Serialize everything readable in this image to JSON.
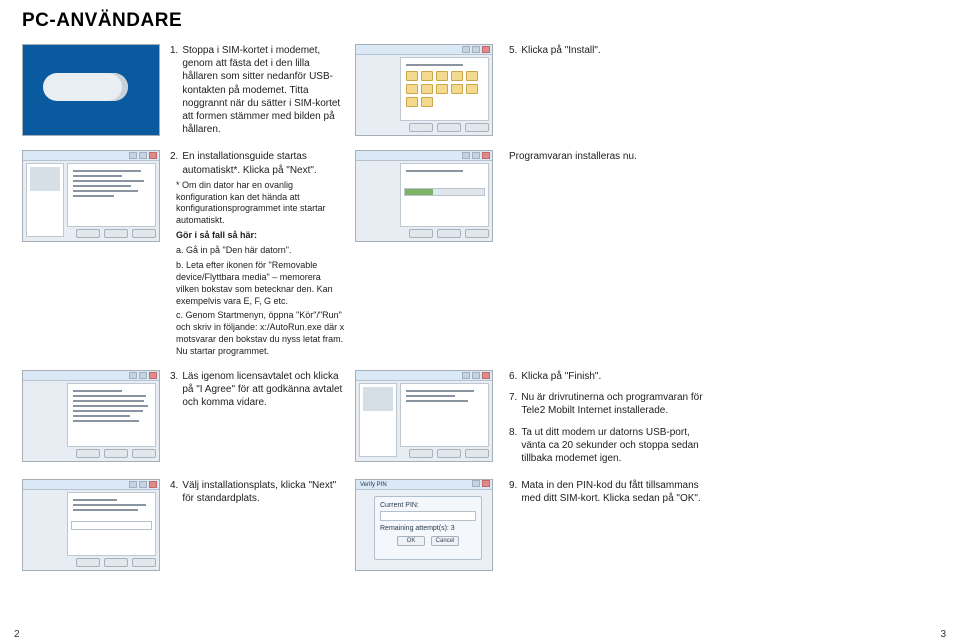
{
  "title": "PC-ANVÄNDARE",
  "page_left": "2",
  "page_right": "3",
  "s1": {
    "num": "1.",
    "body": "Stoppa i SIM-kortet i modemet, genom att fästa det i den lilla hållaren som sitter nedanför USB-kontakten på modemet. Titta noggrannt när du sätter i SIM-kortet att formen stämmer med bilden på hållaren."
  },
  "s5": {
    "num": "5.",
    "body": "Klicka på \"Install\"."
  },
  "s2": {
    "num": "2.",
    "body": "En installationsguide startas automatiskt*. Klicka på \"Next\".",
    "note1": "* Om din dator har en ovanlig konfiguration kan det hända att konfigurationsprogrammet inte startar automatiskt.",
    "note2_head": "Gör i så fall så här:",
    "note2_a": "a. Gå in på \"Den här datorn\".",
    "note2_b": "b. Leta efter ikonen för \"Removable device/Flyttbara media\" – memorera vilken bokstav som betecknar den. Kan exempelvis vara E, F, G etc.",
    "note2_c": "c. Genom Startmenyn, öppna \"Kör\"/\"Run\" och skriv in följande: x:/AutoRun.exe där x motsvarar den bokstav du nyss letat fram. Nu startar programmet."
  },
  "s_prog": "Programvaran installeras nu.",
  "s3": {
    "num": "3.",
    "body": "Läs igenom licensavtalet och klicka på \"I Agree\" för att godkänna avtalet och komma vidare."
  },
  "s6": {
    "num": "6.",
    "body": "Klicka på \"Finish\"."
  },
  "s7": {
    "num": "7.",
    "body": "Nu är drivrutinerna och programvaran för Tele2 Mobilt Internet installerade."
  },
  "s8": {
    "num": "8.",
    "body": "Ta ut ditt modem ur datorns USB-port, vänta ca 20 sekunder och stoppa sedan tillbaka modemet igen."
  },
  "s4": {
    "num": "4.",
    "body": "Välj installationsplats, klicka \"Next\" för standardplats."
  },
  "s9": {
    "num": "9.",
    "body": "Mata in den PIN-kod du fått tillsammans med ditt SIM-kort. Klicka sedan på \"OK\"."
  },
  "pin": {
    "title": "Verify PIN",
    "label": "Current PIN:",
    "remaining": "Remaining attempt(s): 3",
    "ok": "OK",
    "cancel": "Cancel"
  }
}
